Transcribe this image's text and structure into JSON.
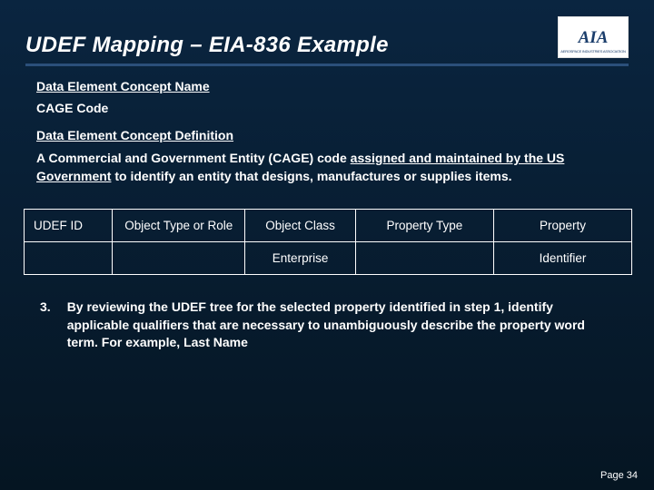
{
  "header": {
    "title": "UDEF Mapping – EIA-836 Example",
    "logo_text": "AIA",
    "logo_sub": "AEROSPACE INDUSTRIES ASSOCIATION"
  },
  "section": {
    "name_label": "Data Element Concept Name",
    "name_value": "CAGE Code",
    "def_label": "Data Element Concept Definition",
    "def_pre": "A Commercial and Government Entity (CAGE) code ",
    "def_u": "assigned and maintained by the US Government",
    "def_post": " to identify an entity that designs, manufactures or supplies items."
  },
  "table": {
    "h1": "UDEF ID",
    "h2": "Object Type or Role",
    "h3": "Object Class",
    "h4": "Property Type",
    "h5": "Property",
    "r1c3": "Enterprise",
    "r1c5": "Identifier"
  },
  "note": {
    "num": "3.",
    "body": "By reviewing the UDEF tree for the selected property identified in step 1, identify applicable qualifiers that are necessary to unambiguously describe the property word term. For example, Last Name"
  },
  "footer": {
    "page": "Page 34"
  }
}
